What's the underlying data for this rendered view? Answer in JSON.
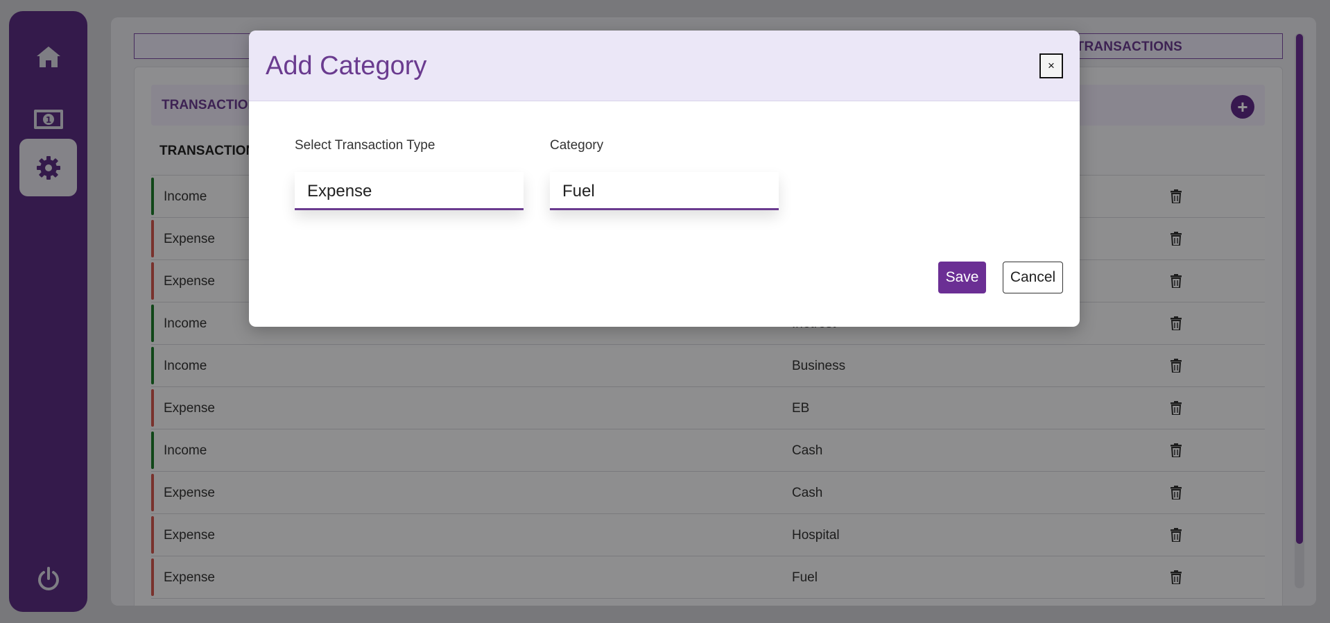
{
  "nav": {
    "items": [
      {
        "icon": "home-icon"
      },
      {
        "icon": "money-icon"
      },
      {
        "icon": "gear-icon",
        "active": true
      }
    ],
    "bottom_icon": "power-icon"
  },
  "main": {
    "top_tab_label": "TRANSACTIONS",
    "card_header_title": "TRANSACTION",
    "table_header": "TRANSACTION",
    "rows": [
      {
        "type": "Income",
        "category": "",
        "color": "#1e7a2c"
      },
      {
        "type": "Expense",
        "category": "",
        "color": "#d0564f"
      },
      {
        "type": "Expense",
        "category": "",
        "color": "#d0564f"
      },
      {
        "type": "Income",
        "category": "Inetrest",
        "color": "#1e7a2c"
      },
      {
        "type": "Income",
        "category": "Business",
        "color": "#1e7a2c"
      },
      {
        "type": "Expense",
        "category": "EB",
        "color": "#d0564f"
      },
      {
        "type": "Income",
        "category": "Cash",
        "color": "#1e7a2c"
      },
      {
        "type": "Expense",
        "category": "Cash",
        "color": "#d0564f"
      },
      {
        "type": "Expense",
        "category": "Hospital",
        "color": "#d0564f"
      },
      {
        "type": "Expense",
        "category": "Fuel",
        "color": "#d0564f"
      }
    ]
  },
  "modal": {
    "title": "Add Category",
    "close_label": "×",
    "type_label": "Select Transaction Type",
    "type_value": "Expense",
    "category_label": "Category",
    "category_value": "Fuel",
    "save_label": "Save",
    "cancel_label": "Cancel"
  },
  "colors": {
    "accent": "#6b2f94",
    "income": "#1e7a2c",
    "expense": "#d0564f"
  }
}
